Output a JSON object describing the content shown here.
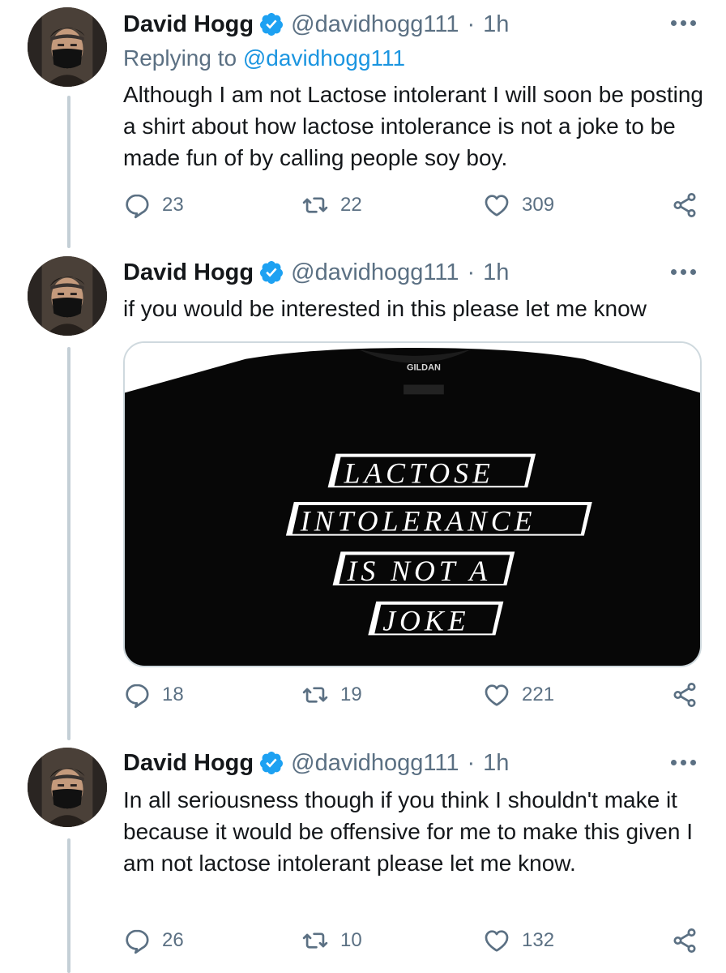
{
  "tweets": [
    {
      "author_name": "David Hogg",
      "author_handle": "@davidhogg111",
      "separator": "·",
      "time": "1h",
      "replying_prefix": "Replying to ",
      "replying_to": "@davidhogg111",
      "text": "Although I am not Lactose intolerant I will soon be posting a shirt about how lactose intolerance is not a joke to be made fun of by calling people soy boy.",
      "replies": "23",
      "retweets": "22",
      "likes": "309"
    },
    {
      "author_name": "David Hogg",
      "author_handle": "@davidhogg111",
      "separator": "·",
      "time": "1h",
      "text": "if you would be interested in this please let me know",
      "media": {
        "brand_tag": "GILDAN",
        "shirt_lines": [
          "LACTOSE",
          "INTOLERANCE",
          "IS NOT A",
          "JOKE"
        ]
      },
      "replies": "18",
      "retweets": "19",
      "likes": "221"
    },
    {
      "author_name": "David Hogg",
      "author_handle": "@davidhogg111",
      "separator": "·",
      "time": "1h",
      "text": "In all seriousness though if you think I shouldn't make it because it would be offensive for me to make this given I am not lactose intolerant please let me know.",
      "replies": "26",
      "retweets": "10",
      "likes": "132"
    }
  ],
  "icons": {
    "verified": "verified-badge-icon",
    "more": "more-options-icon",
    "reply": "reply-bubble-icon",
    "retweet": "retweet-arrows-icon",
    "like": "heart-icon",
    "share": "share-icon"
  },
  "colors": {
    "verified_blue": "#1da1f2",
    "link_blue": "#1b95e0",
    "muted_gray": "#5b7083",
    "thread_line": "#c4cfd6"
  }
}
